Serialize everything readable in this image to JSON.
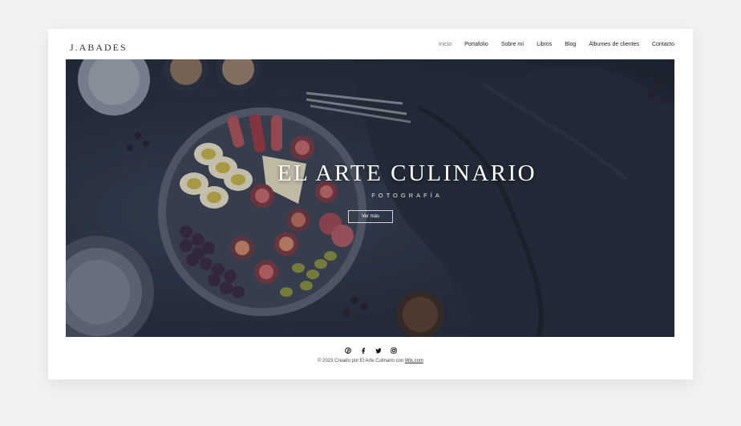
{
  "header": {
    "logo": "J.ABADES",
    "nav": [
      {
        "label": "Inicio",
        "active": true
      },
      {
        "label": "Portafolio"
      },
      {
        "label": "Sobre mí"
      },
      {
        "label": "Libros"
      },
      {
        "label": "Blog"
      },
      {
        "label": "Álbumes de clientes"
      },
      {
        "label": "Contacto"
      }
    ]
  },
  "hero": {
    "title": "EL ARTE CULINARIO",
    "subtitle": "FOTOGRAFÍA",
    "button": "Ver más"
  },
  "footer": {
    "social": [
      "pinterest-icon",
      "facebook-icon",
      "twitter-icon",
      "instagram-icon"
    ],
    "text": "© 2023 Creado por El Arte Culinario con ",
    "link": "Wix.com"
  },
  "colors": {
    "page_bg": "#f2f2f2",
    "hero_dark": "#1d2431",
    "text": "#222222"
  }
}
